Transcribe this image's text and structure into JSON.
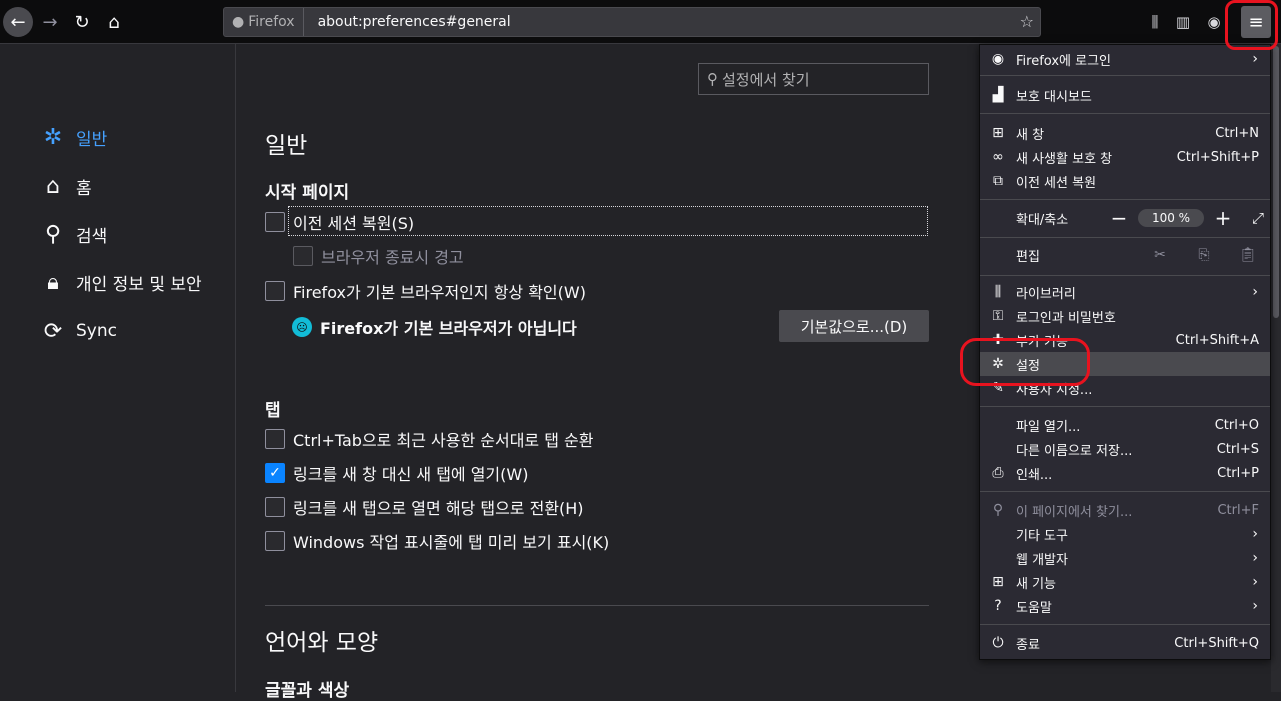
{
  "toolbar": {
    "url_identity": "Firefox",
    "url": "about:preferences#general"
  },
  "sidebar": {
    "items": [
      {
        "label": "일반",
        "icon": "gear-icon"
      },
      {
        "label": "홈",
        "icon": "home-icon"
      },
      {
        "label": "검색",
        "icon": "search-icon"
      },
      {
        "label": "개인 정보 및 보안",
        "icon": "lock-icon"
      },
      {
        "label": "Sync",
        "icon": "sync-icon"
      }
    ]
  },
  "main": {
    "search_placeholder": "설정에서 찾기",
    "title": "일반",
    "startup": {
      "heading": "시작 페이지",
      "restore_session": "이전 세션 복원(S)",
      "warn_on_quit": "브라우저 종료시 경고",
      "check_default": "Firefox가 기본 브라우저인지 항상 확인(W)",
      "not_default_msg": "Firefox가 기본 브라우저가 아닙니다",
      "make_default_btn": "기본값으로...(D)"
    },
    "tabs": {
      "heading": "탭",
      "ctrl_tab": "Ctrl+Tab으로 최근 사용한 순서대로 탭 순환",
      "open_links_in_tabs": "링크를 새 창 대신 새 탭에 열기(W)",
      "switch_to_new_tab": "링크를 새 탭으로 열면 해당 탭으로 전환(H)",
      "taskbar_previews": "Windows 작업 표시줄에 탭 미리 보기 표시(K)"
    },
    "language_title": "언어와 모양",
    "fonts_heading": "글꼴과 색상"
  },
  "menu": {
    "signin": "Firefox에 로그인",
    "protections": "보호 대시보드",
    "new_window": {
      "label": "새 창",
      "key": "Ctrl+N"
    },
    "private_window": {
      "label": "새 사생활 보호 창",
      "key": "Ctrl+Shift+P"
    },
    "restore_session": "이전 세션 복원",
    "zoom": {
      "label": "확대/축소",
      "minus": "−",
      "value": "100 %",
      "plus": "+"
    },
    "edit": "편집",
    "library": "라이브러리",
    "logins": "로그인과 비밀번호",
    "addons": {
      "label": "부가 기능",
      "key": "Ctrl+Shift+A"
    },
    "settings": "설정",
    "customize": "사용자 지정...",
    "open_file": {
      "label": "파일 열기...",
      "key": "Ctrl+O"
    },
    "save_as": {
      "label": "다른 이름으로 저장...",
      "key": "Ctrl+S"
    },
    "print": {
      "label": "인쇄...",
      "key": "Ctrl+P"
    },
    "find": {
      "label": "이 페이지에서 찾기...",
      "key": "Ctrl+F"
    },
    "more_tools": "기타 도구",
    "web_dev": "웹 개발자",
    "whats_new": "새 기능",
    "help": "도움말",
    "quit": {
      "label": "종료",
      "key": "Ctrl+Shift+Q"
    }
  },
  "colors": {
    "accent": "#0a84ff",
    "selected_category": "#45a1ff",
    "highlight_ring": "#e8131f"
  }
}
